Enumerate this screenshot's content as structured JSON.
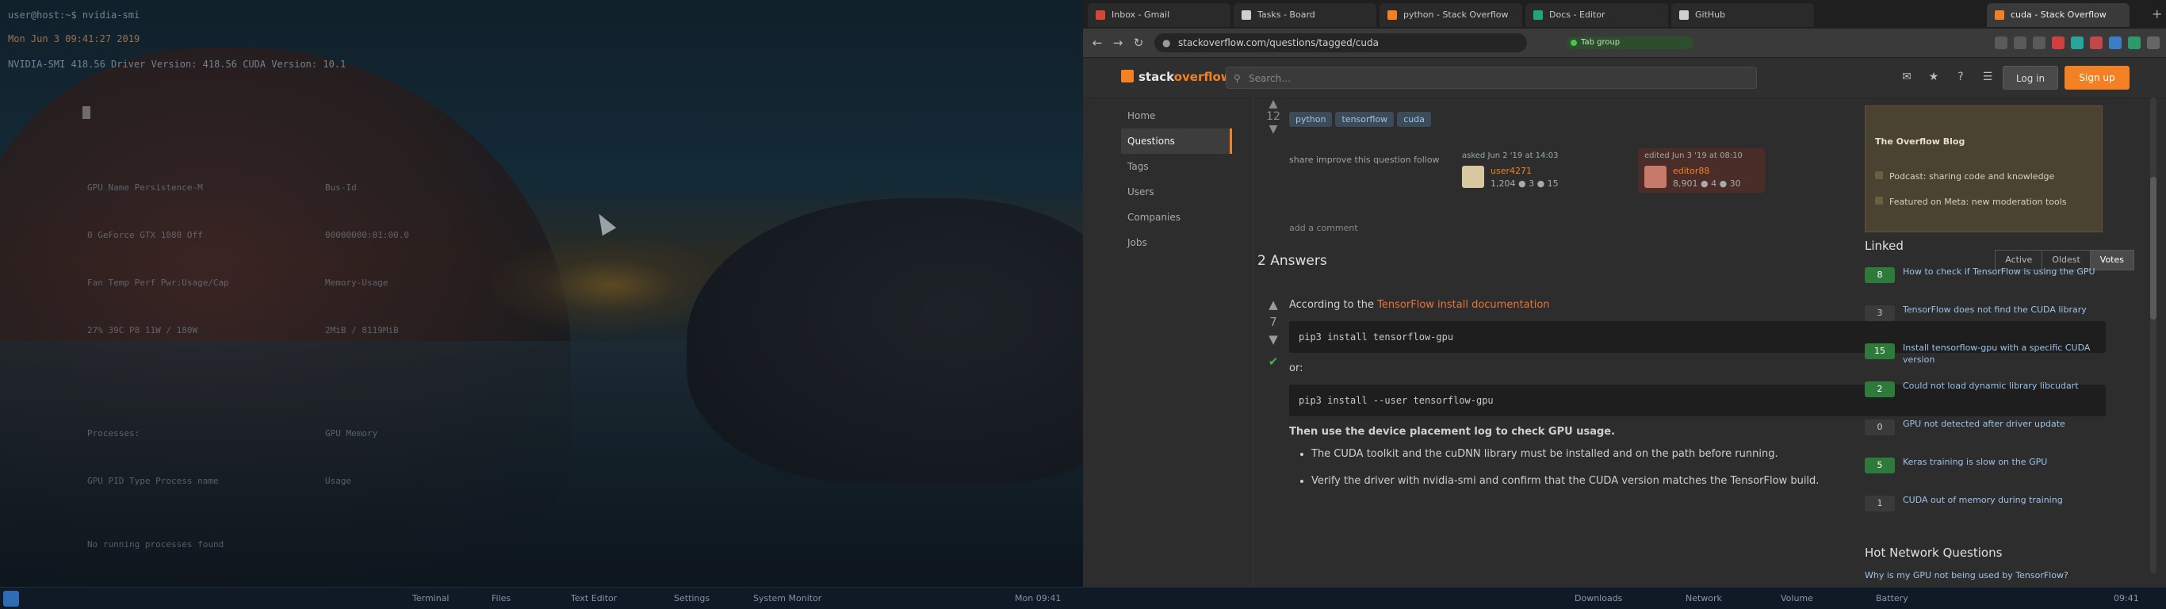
{
  "terminal": {
    "lines": [
      "user@host:~$ nvidia-smi",
      "Mon Jun  3 09:41:27 2019",
      "NVIDIA-SMI 418.56    Driver Version: 418.56    CUDA Version: 10.1"
    ],
    "rows": [
      {
        "left": "GPU  Name        Persistence-M",
        "right": "Bus-Id"
      },
      {
        "left": "0  GeForce GTX 1080    Off",
        "right": "00000000:01:00.0"
      },
      {
        "left": "Fan  Temp  Perf  Pwr:Usage/Cap",
        "right": "Memory-Usage"
      },
      {
        "left": "27%   39C    P8   11W / 180W",
        "right": "2MiB / 8119MiB"
      },
      {
        "left": "Processes:",
        "right": "GPU Memory"
      },
      {
        "left": "GPU       PID   Type   Process name",
        "right": "Usage"
      },
      {
        "left": "No running processes found",
        "right": ""
      }
    ]
  },
  "left_taskbar": {
    "items": [
      "Terminal",
      "Files",
      "Text Editor",
      "Settings",
      "System Monitor",
      "Mon 09:41"
    ]
  },
  "browser": {
    "tabs": [
      {
        "label": "Inbox - Gmail",
        "color": "#d14836"
      },
      {
        "label": "Tasks - Board",
        "color": "#cfcfcf"
      },
      {
        "label": "python - Stack Overflow",
        "color": "#f48024"
      },
      {
        "label": "Docs - Editor",
        "color": "#1fa67a"
      },
      {
        "label": "GitHub",
        "color": "#cfcfcf"
      },
      {
        "label": "cuda - Stack Overflow",
        "color": "#f48024"
      }
    ],
    "url": "stackoverflow.com/questions/tagged/cuda",
    "extension_pill": "Tab group",
    "newtab_label": "+"
  },
  "site": {
    "logo_text": "stack",
    "logo_accent": "overflow",
    "search_placeholder": "Search…",
    "login_label": "Log in",
    "signup_label": "Sign up",
    "nav": [
      "Home",
      "Questions",
      "Tags",
      "Users",
      "Companies",
      "Jobs"
    ],
    "question": {
      "up": "▲",
      "score": "12",
      "down": "▼",
      "tags": [
        "python",
        "tensorflow",
        "cuda"
      ],
      "share": "share  improve this question  follow",
      "asked_when": "asked Jun 2 '19 at 14:03",
      "asked_name": "user4271",
      "asked_rep": "1,204  ● 3  ● 15",
      "edited_when": "edited Jun 3 '19 at 08:10",
      "edited_name": "editor88",
      "edited_rep": "8,901  ● 4  ● 30",
      "add_comment": "add a comment"
    },
    "answers": {
      "count": "2 Answers",
      "sort": [
        "Active",
        "Oldest",
        "Votes"
      ],
      "up": "▲",
      "score": "7",
      "down": "▼",
      "intro": "According to the",
      "intro_link": "TensorFlow install documentation",
      "code1": "pip3 install tensorflow-gpu",
      "p2": "or:",
      "code2": "pip3 install --user tensorflow-gpu",
      "p3": "Then use the device placement log to check GPU usage.",
      "bullets": [
        "The CUDA toolkit and the cuDNN library must be installed and on the path before running.",
        "Verify the driver with nvidia-smi and confirm that the CUDA version matches the TensorFlow build."
      ]
    },
    "sidebar": {
      "blog_heading": "The Overflow Blog",
      "blog_items": [
        "Podcast: sharing code and knowledge",
        "Featured on Meta: new moderation tools"
      ],
      "linked_heading": "Linked",
      "linked": [
        {
          "votes": "8",
          "accepted": true,
          "title": "How to check if TensorFlow is using the GPU"
        },
        {
          "votes": "3",
          "accepted": false,
          "title": "TensorFlow does not find the CUDA library"
        },
        {
          "votes": "15",
          "accepted": true,
          "title": "Install tensorflow-gpu with a specific CUDA version"
        },
        {
          "votes": "2",
          "accepted": true,
          "title": "Could not load dynamic library libcudart"
        },
        {
          "votes": "0",
          "accepted": false,
          "title": "GPU not detected after driver update"
        },
        {
          "votes": "5",
          "accepted": true,
          "title": "Keras training is slow on the GPU"
        },
        {
          "votes": "1",
          "accepted": false,
          "title": "CUDA out of memory during training"
        }
      ],
      "related_heading": "Hot Network Questions",
      "related_first": "Why is my GPU not being used by TensorFlow?"
    }
  },
  "right_taskbar": {
    "items": [
      "Downloads",
      "Network",
      "Volume",
      "Battery",
      "09:41"
    ]
  }
}
